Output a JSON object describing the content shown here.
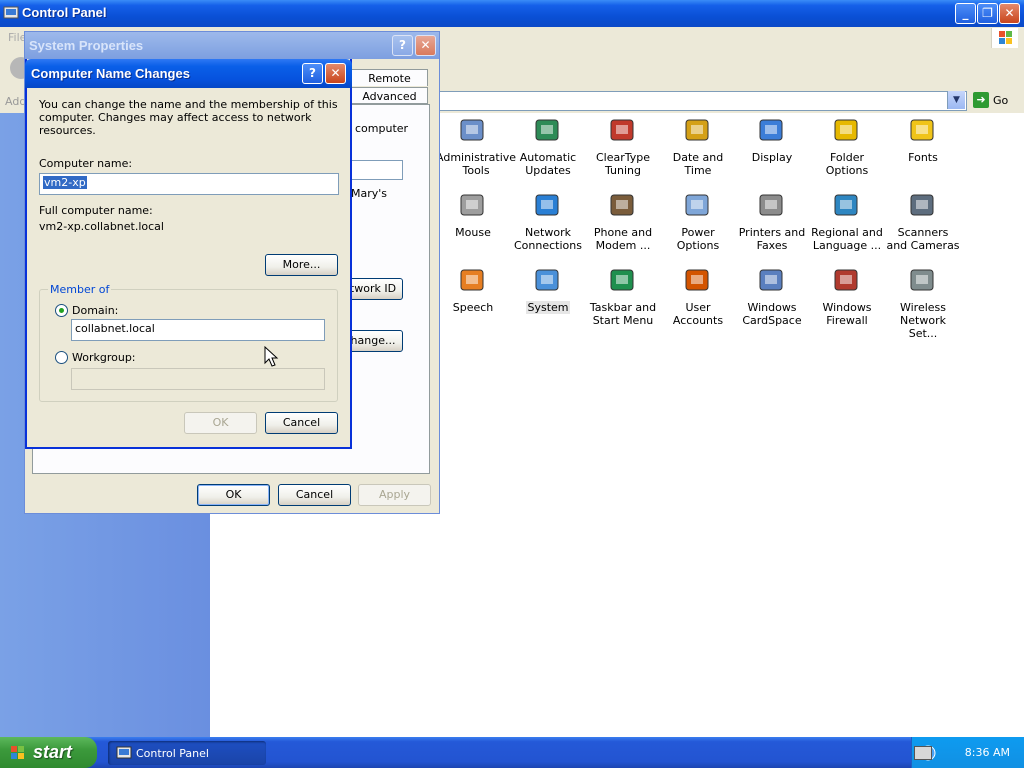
{
  "control_panel": {
    "title": "Control Panel",
    "menu_partial": "File",
    "address_partial": "Add",
    "go_label": "Go",
    "items": [
      {
        "label": "Administrative Tools",
        "icon": "administrative-tools-icon"
      },
      {
        "label": "Automatic Updates",
        "icon": "automatic-updates-icon"
      },
      {
        "label": "ClearType Tuning",
        "icon": "cleartype-icon"
      },
      {
        "label": "Date and Time",
        "icon": "date-time-icon"
      },
      {
        "label": "Display",
        "icon": "display-icon"
      },
      {
        "label": "Folder Options",
        "icon": "folder-options-icon"
      },
      {
        "label": "Fonts",
        "icon": "fonts-icon"
      },
      {
        "label": "Mouse",
        "icon": "mouse-icon"
      },
      {
        "label": "Network Connections",
        "icon": "network-connections-icon"
      },
      {
        "label": "Phone and Modem ...",
        "icon": "phone-modem-icon"
      },
      {
        "label": "Power Options",
        "icon": "power-options-icon"
      },
      {
        "label": "Printers and Faxes",
        "icon": "printers-faxes-icon"
      },
      {
        "label": "Regional and Language ...",
        "icon": "regional-language-icon"
      },
      {
        "label": "Scanners and Cameras",
        "icon": "scanners-cameras-icon"
      },
      {
        "label": "Speech",
        "icon": "speech-icon"
      },
      {
        "label": "System",
        "icon": "system-icon"
      },
      {
        "label": "Taskbar and Start Menu",
        "icon": "taskbar-start-menu-icon"
      },
      {
        "label": "User Accounts",
        "icon": "user-accounts-icon"
      },
      {
        "label": "Windows CardSpace",
        "icon": "cardspace-icon"
      },
      {
        "label": "Windows Firewall",
        "icon": "firewall-icon"
      },
      {
        "label": "Wireless Network Set...",
        "icon": "wireless-network-icon"
      }
    ]
  },
  "system_properties": {
    "title": "System Properties",
    "tabs": [
      "Remote",
      "Advanced"
    ],
    "partial_text_1": "computer",
    "partial_text_2": "Mary's",
    "network_id_partial": "twork ID",
    "change_partial": "hange...",
    "ok": "OK",
    "cancel": "Cancel",
    "apply": "Apply"
  },
  "computer_name_changes": {
    "title": "Computer Name Changes",
    "description": "You can change the name and the membership of this computer. Changes may affect access to network resources.",
    "computer_name_label": "Computer name:",
    "computer_name_value": "vm2-xp",
    "full_name_label": "Full computer name:",
    "full_name_value": "vm2-xp.collabnet.local",
    "more_button": "More...",
    "member_of_label": "Member of",
    "domain_label": "Domain:",
    "domain_value": "collabnet.local",
    "workgroup_label": "Workgroup:",
    "workgroup_value": "",
    "ok": "OK",
    "cancel": "Cancel"
  },
  "taskbar": {
    "start": "start",
    "task_control_panel": "Control Panel",
    "clock": "8:36 AM"
  },
  "colors": {
    "title_active": "#0a50d6",
    "dialog_face": "#ece9d8",
    "start_green": "#3c9a3c",
    "selection": "#316ac5"
  }
}
